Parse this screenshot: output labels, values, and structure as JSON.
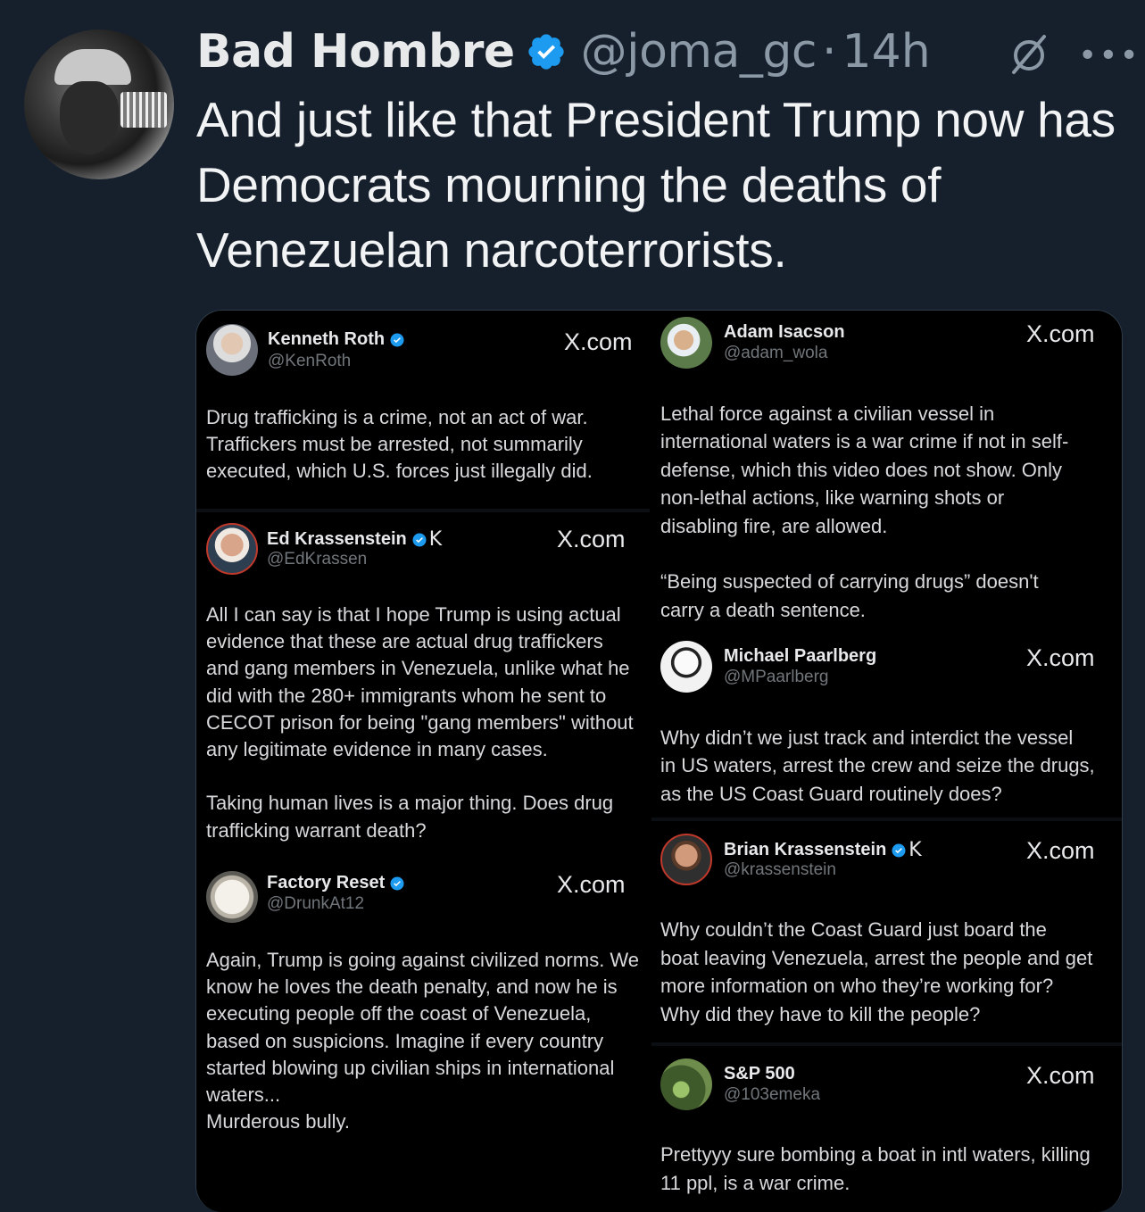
{
  "author": {
    "display_name": "Bad Hombre",
    "handle": "@joma_gc",
    "separator": "·",
    "time": "14h",
    "verified": true,
    "icons": [
      "grok-icon",
      "more-icon"
    ]
  },
  "tweet": {
    "text": "And just like that President Trump now has Democrats mourning the deaths of Venezuelan narcoterrorists."
  },
  "colors": {
    "background": "#16202c",
    "verified_blue": "#1d9bf0",
    "secondary_text": "#8b98a5"
  },
  "embedded_posts": [
    {
      "name": "Kenneth Roth",
      "handle": "@KenRoth",
      "source": "X.com",
      "text": "Drug trafficking is a crime, not an act of war.\nTraffickers must be arrested, not summarily\nexecuted, which U.S. forces just illegally did."
    },
    {
      "name": "Ed Krassenstein",
      "handle": "@EdKrassen",
      "source": "X.com",
      "badge": "K",
      "text": "All I can say is that I hope Trump is using actual\nevidence that these are actual drug traffickers\nand gang members in Venezuela, unlike what he\ndid with the 280+ immigrants whom he sent to\nCECOT prison for being \"gang members\" without\nany legitimate evidence in many cases.\n\nTaking human lives is a major thing. Does drug\ntrafficking warrant death?"
    },
    {
      "name": "Factory Reset",
      "handle": "@DrunkAt12",
      "source": "X.com",
      "text": "Again, Trump is going against civilized norms. We\nknow he loves the death penalty, and now he is\nexecuting people off the coast of Venezuela,\nbased on suspicions. Imagine if every country\nstarted blowing up civilian ships in international\nwaters...\nMurderous bully."
    },
    {
      "name": "Adam Isacson",
      "handle": "@adam_wola",
      "source": "X.com",
      "text": "Lethal force against a civilian vessel in\ninternational waters is a war crime if not in self-\ndefense, which this video does not show. Only\nnon-lethal actions, like warning shots or\ndisabling fire, are allowed.\n\n“Being suspected of carrying drugs” doesn't\ncarry a death sentence."
    },
    {
      "name": "Michael Paarlberg",
      "handle": "@MPaarlberg",
      "source": "X.com",
      "text": "Why didn’t we just track and interdict the vessel\nin US waters, arrest the crew and seize the drugs,\nas the US Coast Guard routinely does?"
    },
    {
      "name": "Brian Krassenstein",
      "handle": "@krassenstein",
      "source": "X.com",
      "badge": "K",
      "text": "Why couldn’t the Coast Guard just board the\nboat leaving Venezuela, arrest the people and get\nmore information on who they’re working for?\nWhy did they have to kill the people?"
    },
    {
      "name": "S&P 500",
      "handle": "@103emeka",
      "source": "X.com",
      "text": "Prettyyy sure bombing a boat in intl waters, killing\n11 ppl, is a war crime."
    }
  ]
}
